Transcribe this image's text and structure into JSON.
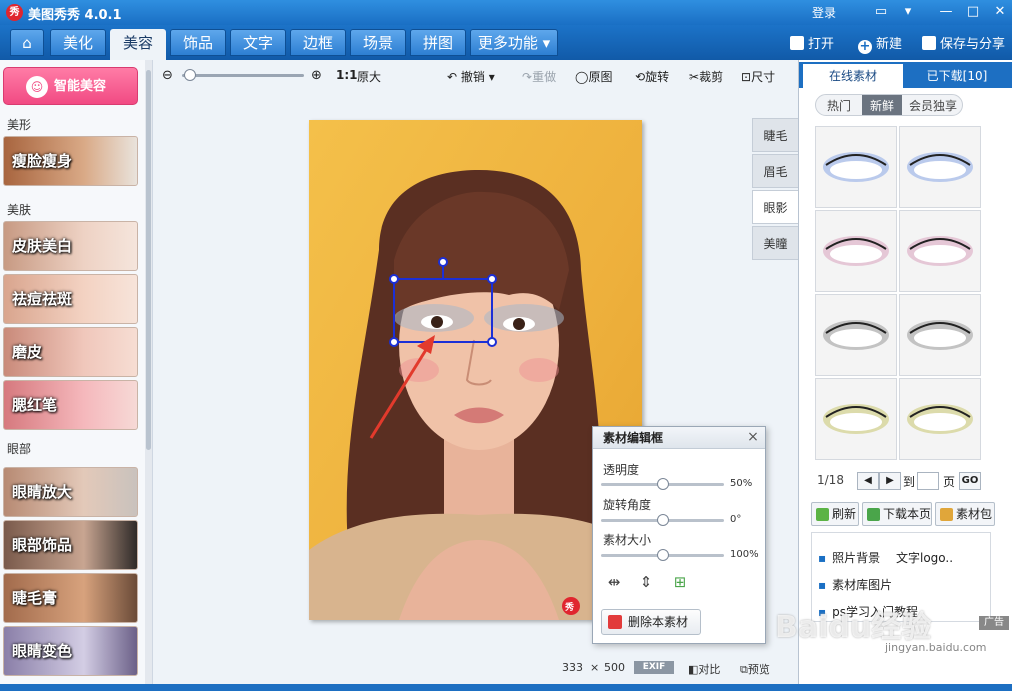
{
  "app": {
    "title": "美图秀秀 4.0.1",
    "logo_text": "秀",
    "login": "登录"
  },
  "nav": {
    "tabs": [
      {
        "label": "美化"
      },
      {
        "label": "美容"
      },
      {
        "label": "饰品"
      },
      {
        "label": "文字"
      },
      {
        "label": "边框"
      },
      {
        "label": "场景"
      },
      {
        "label": "拼图"
      },
      {
        "label": "更多功能"
      }
    ],
    "active_tab": "美容",
    "open_label": "打开",
    "new_label": "新建",
    "save_label": "保存与分享"
  },
  "sidebar": {
    "smart_beauty": "智能美容",
    "categories": {
      "shape": "美形",
      "skin": "美肤",
      "eye": "眼部"
    },
    "items": [
      "瘦脸瘦身",
      "皮肤美白",
      "祛痘祛斑",
      "磨皮",
      "腮红笔",
      "眼睛放大",
      "眼部饰品",
      "睫毛膏",
      "眼睛变色"
    ]
  },
  "toolbar": {
    "ratio_label": "1:1",
    "actual_size": "原大",
    "undo": "撤销",
    "redo": "重做",
    "original": "原图",
    "rotate": "旋转",
    "crop": "裁剪",
    "resize": "尺寸"
  },
  "eye_tabs": [
    "睫毛",
    "眉毛",
    "眼影",
    "美瞳"
  ],
  "active_eye_tab": "眼影",
  "right_panel": {
    "tabs": [
      "在线素材",
      "已下载[10]"
    ],
    "sub_tabs": [
      "热门",
      "新鲜",
      "会员独享"
    ],
    "active_sub_tab": "新鲜",
    "swatch_colors": [
      "#8aa8e6",
      "#8aa8e6",
      "#d8a3bd",
      "#d8a3bd",
      "#9a9a9a",
      "#9a9a9a",
      "#c9c770",
      "#c9c770"
    ],
    "pager": {
      "page": "1/18",
      "prev": "◀",
      "next": "▶",
      "goto_label": "到",
      "page_label": "页",
      "go_label": "GO"
    },
    "actions": [
      "刷新",
      "下载本页",
      "素材包"
    ],
    "links": [
      "照片背景",
      "文字logo..",
      "素材库图片",
      "ps学习入门教程"
    ],
    "ad_label": "广告"
  },
  "edit_box": {
    "title": "素材编辑框",
    "close": "×",
    "opacity_label": "透明度",
    "opacity_value": "50%",
    "opacity_fraction": 0.5,
    "rotation_label": "旋转角度",
    "rotation_value": "0°",
    "rotation_fraction": 0.5,
    "size_label": "素材大小",
    "size_value": "100%",
    "size_fraction": 0.5,
    "delete_label": "删除本素材"
  },
  "status": {
    "width": "333",
    "times": "×",
    "height": "500",
    "exif": "EXIF",
    "compare": "对比",
    "preview": "预览"
  },
  "photo_badge": "秀",
  "watermark": {
    "main": "Baidu经验",
    "sub": "jingyan.baidu.com"
  }
}
